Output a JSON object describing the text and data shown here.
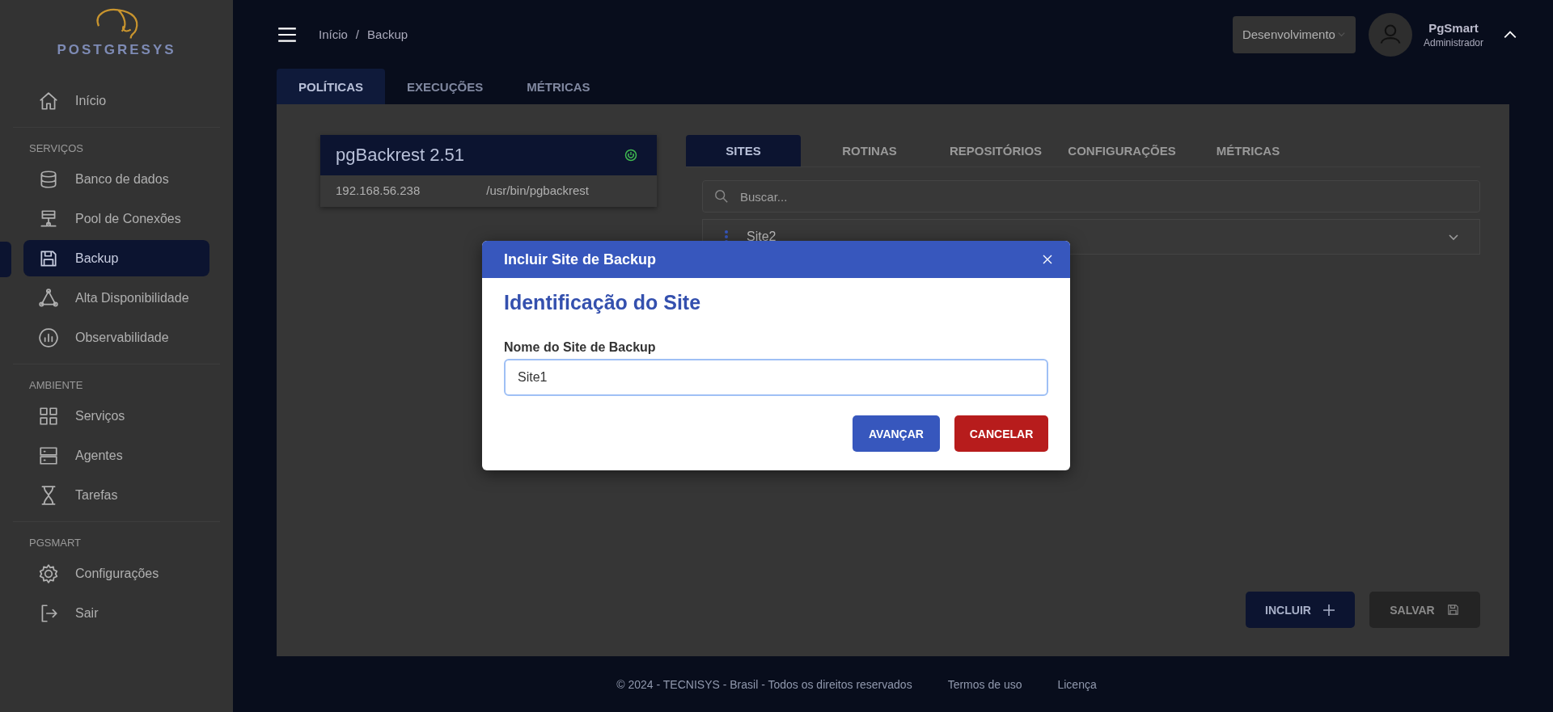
{
  "sidebar": {
    "logo_text": "POSTGRESYS",
    "sections": [
      {
        "items": [
          {
            "label": "Início",
            "selected": false
          }
        ]
      },
      {
        "title": "SERVIÇOS",
        "items": [
          {
            "label": "Banco de dados",
            "selected": false
          },
          {
            "label": "Pool de Conexões",
            "selected": false
          },
          {
            "label": "Backup",
            "selected": true
          },
          {
            "label": "Alta Disponibilidade",
            "selected": false
          },
          {
            "label": "Observabilidade",
            "selected": false
          }
        ]
      },
      {
        "title": "AMBIENTE",
        "items": [
          {
            "label": "Serviços",
            "selected": false
          },
          {
            "label": "Agentes",
            "selected": false
          },
          {
            "label": "Tarefas",
            "selected": false
          }
        ]
      },
      {
        "title": "PGSMART",
        "items": [
          {
            "label": "Configurações",
            "selected": false
          },
          {
            "label": "Sair",
            "selected": false
          }
        ]
      }
    ]
  },
  "header": {
    "breadcrumb": [
      "Início",
      "Backup"
    ],
    "breadcrumb_separator": "/",
    "environment": "Desenvolvimento",
    "user_name": "PgSmart",
    "user_role": "Administrador"
  },
  "main_tabs": [
    {
      "label": "POLÍTICAS",
      "selected": true
    },
    {
      "label": "EXECUÇÕES",
      "selected": false
    },
    {
      "label": "MÉTRICAS",
      "selected": false
    }
  ],
  "server_card": {
    "title": "pgBackrest 2.51",
    "host": "192.168.56.238",
    "path": "/usr/bin/pgbackrest"
  },
  "sub_tabs": [
    {
      "label": "SITES",
      "selected": true
    },
    {
      "label": "ROTINAS",
      "selected": false
    },
    {
      "label": "REPOSITÓRIOS",
      "selected": false
    },
    {
      "label": "CONFIGURAÇÕES",
      "selected": false
    },
    {
      "label": "MÉTRICAS",
      "selected": false
    }
  ],
  "search": {
    "placeholder": "Buscar..."
  },
  "sites": [
    {
      "name": "Site2"
    }
  ],
  "actions": [
    {
      "label": "INCLUIR",
      "disabled": false
    },
    {
      "label": "SALVAR",
      "disabled": true
    }
  ],
  "modal": {
    "title": "Incluir Site de Backup",
    "heading": "Identificação do Site",
    "field_label": "Nome do Site de Backup",
    "field_value": "Site1",
    "buttons": [
      {
        "label": "AVANÇAR",
        "kind": "primary"
      },
      {
        "label": "CANCELAR",
        "kind": "danger"
      }
    ]
  },
  "footer": {
    "copyright": "© 2024 - TECNISYS - Brasil - Todos os direitos reservados",
    "links": [
      "Termos de uso",
      "Licença"
    ]
  }
}
